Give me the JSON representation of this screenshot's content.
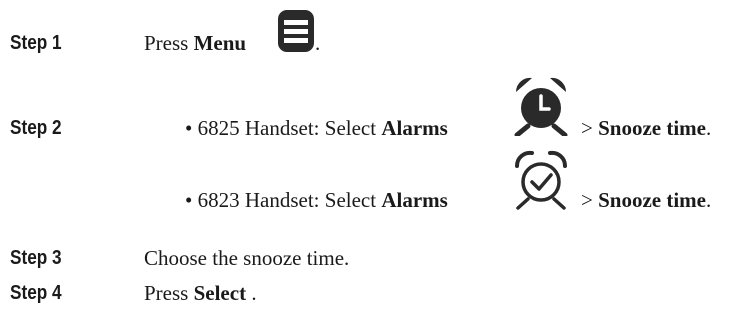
{
  "steps": [
    {
      "label": "Step 1",
      "parts": {
        "press": "Press",
        "menu": "Menu",
        "period": "."
      },
      "icon": "menu-icon"
    },
    {
      "label": "Step 2",
      "bullets": [
        {
          "bullet": "•",
          "model": "6825 Handset:",
          "select": "Select",
          "alarms": "Alarms",
          "sep": ">",
          "snooze": "Snooze time",
          "period": ".",
          "icon": "alarm-clock-filled-icon"
        },
        {
          "bullet": "•",
          "model": "6823 Handset:",
          "select": "Select",
          "alarms": "Alarms",
          "sep": ">",
          "snooze": "Snooze time",
          "period": ".",
          "icon": "alarm-clock-check-icon"
        }
      ]
    },
    {
      "label": "Step 3",
      "text": "Choose the snooze time."
    },
    {
      "label": "Step 4",
      "parts": {
        "press": "Press",
        "select": "Select",
        "period": "."
      }
    }
  ]
}
